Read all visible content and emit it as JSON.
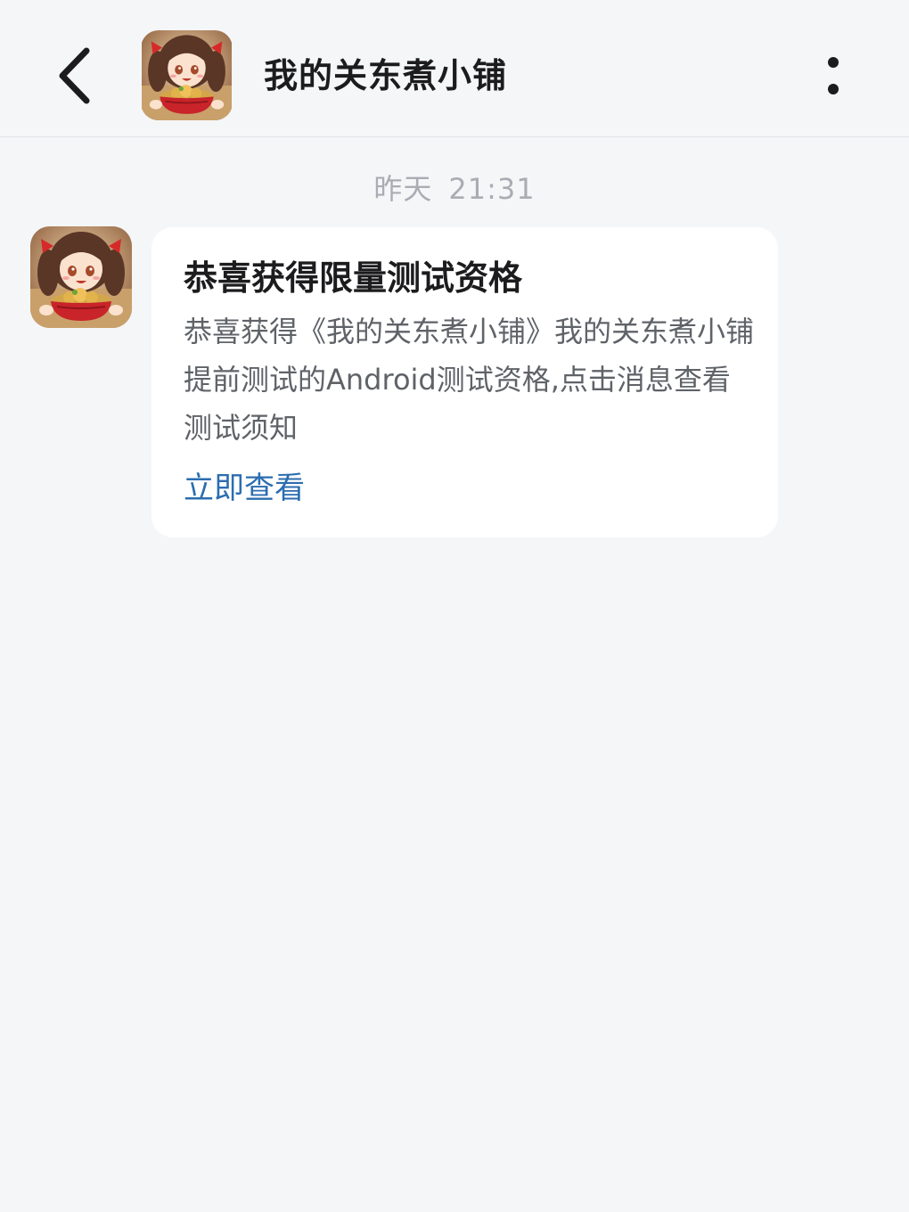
{
  "header": {
    "title": "我的关东煮小铺",
    "back_icon": "chevron-left-icon",
    "more_icon": "more-vertical-icon",
    "avatar_icon": "game-avatar-icon"
  },
  "conversation": {
    "timestamp_day": "昨天",
    "timestamp_time": "21:31",
    "message": {
      "avatar_icon": "game-avatar-icon",
      "title": "恭喜获得限量测试资格",
      "body": "恭喜获得《我的关东煮小铺》我的关东煮小铺提前测试的Android测试资格,点击消息查看测试须知",
      "action_label": "立即查看"
    }
  },
  "colors": {
    "background": "#f5f6f8",
    "card": "#ffffff",
    "title_text": "#1c1c1e",
    "body_text": "#5f6368",
    "timestamp_text": "#a9adb3",
    "link": "#2b6db0"
  }
}
